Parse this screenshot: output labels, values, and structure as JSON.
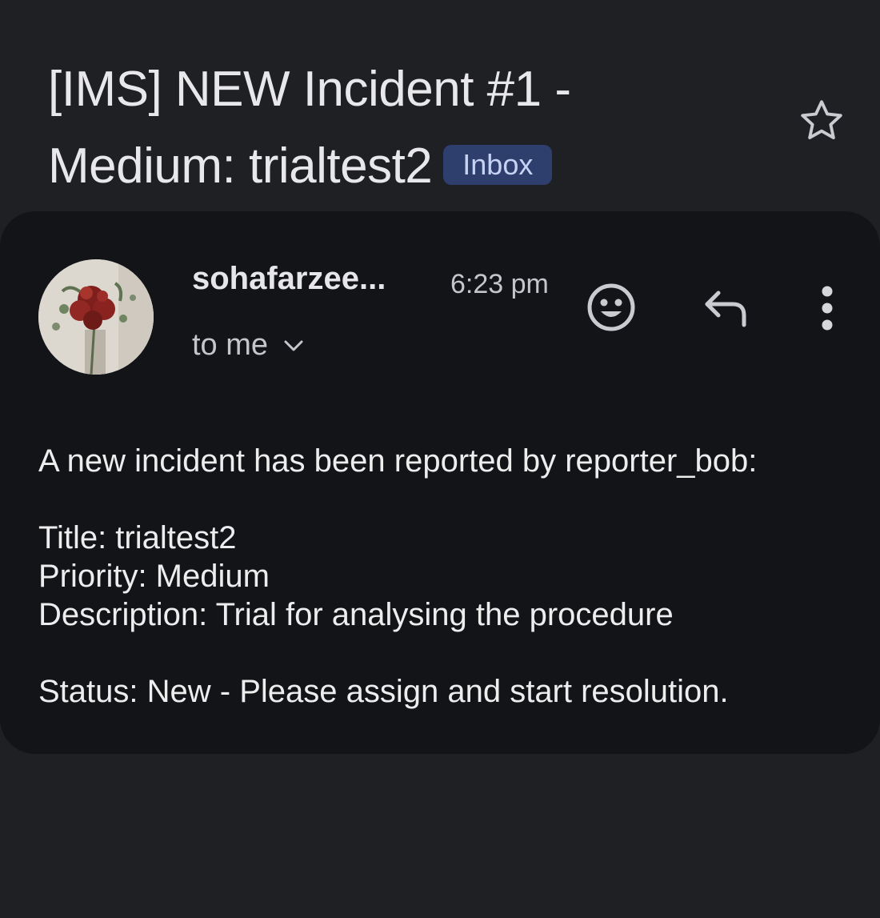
{
  "subject": {
    "title": "[IMS] NEW Incident #1 - Medium: trialtest2",
    "label": "Inbox"
  },
  "message": {
    "sender": "sohafarzee...",
    "time": "6:23 pm",
    "recipient": "to me",
    "body": {
      "intro": "A new incident has been reported by reporter_bob:",
      "title_line": "Title: trialtest2",
      "priority_line": "Priority: Medium",
      "description_line": "Description: Trial for analysing the procedure",
      "status_line": "Status: New - Please assign and start resolution."
    }
  },
  "icons": {
    "star": "star-outline-icon",
    "emoji": "add-reaction-icon",
    "reply": "reply-icon",
    "more": "more-vert-icon",
    "expand": "chevron-down-icon"
  },
  "colors": {
    "background": "#1f2024",
    "card": "#131418",
    "badge_bg": "#2e3f6e",
    "badge_text": "#c7d3f5"
  }
}
